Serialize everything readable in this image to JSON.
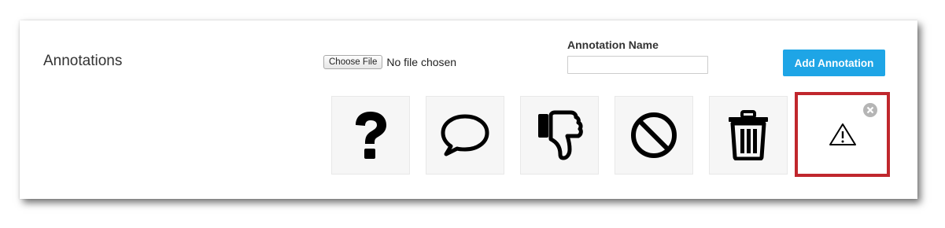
{
  "annotations": {
    "title": "Annotations",
    "file_picker": {
      "button_label": "Choose File",
      "status": "No file chosen"
    },
    "name_field": {
      "label": "Annotation Name",
      "value": ""
    },
    "add_button_label": "Add Annotation",
    "icons": [
      {
        "icon": "question-mark-icon",
        "selected": false
      },
      {
        "icon": "speech-bubble-icon",
        "selected": false
      },
      {
        "icon": "thumbs-down-icon",
        "selected": false
      },
      {
        "icon": "prohibited-icon",
        "selected": false
      },
      {
        "icon": "trash-icon",
        "selected": false
      },
      {
        "icon": "warning-icon",
        "selected": true
      }
    ],
    "colors": {
      "accent_button": "#1ea5e6",
      "selected_border": "#c0272d",
      "tile_background": "#f6f6f6"
    }
  }
}
